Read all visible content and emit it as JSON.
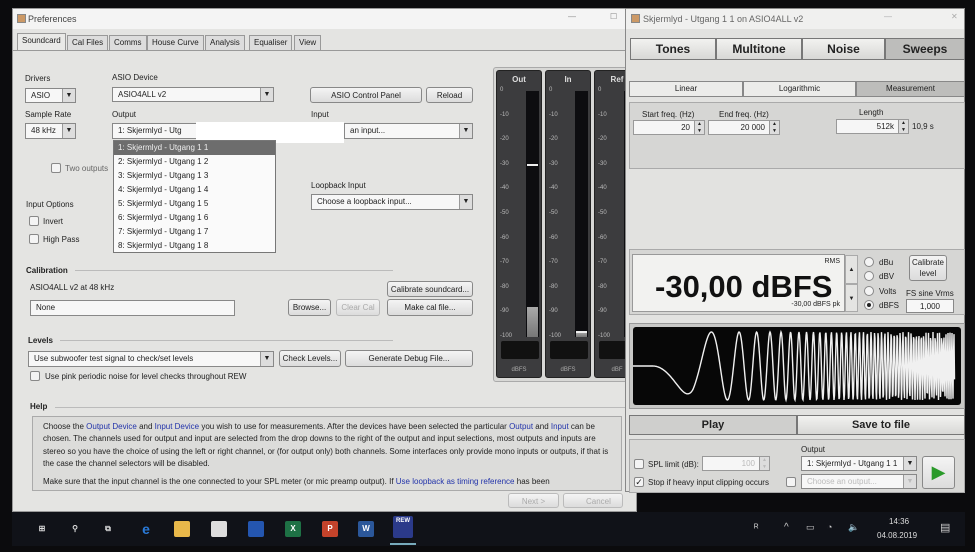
{
  "prefs": {
    "title": "Preferences",
    "tabs": [
      "Soundcard",
      "Cal Files",
      "Comms",
      "House Curve",
      "Analysis",
      "Equaliser",
      "View"
    ],
    "drivers_label": "Drivers",
    "drivers_value": "ASIO",
    "asio_device_label": "ASIO Device",
    "asio_device_value": "ASIO4ALL v2",
    "asio_control_panel": "ASIO Control Panel",
    "reload": "Reload",
    "sample_rate_label": "Sample Rate",
    "sample_rate_value": "48 kHz",
    "output_label": "Output",
    "output_value": "1: Skjermlyd - Utg",
    "input_label": "Input",
    "input_value": "an input...",
    "output_options": [
      "1: Skjermlyd - Utgang 1 1",
      "2: Skjermlyd - Utgang 1 2",
      "3: Skjermlyd - Utgang 1 3",
      "4: Skjermlyd - Utgang 1 4",
      "5: Skjermlyd - Utgang 1 5",
      "6: Skjermlyd - Utgang 1 6",
      "7: Skjermlyd - Utgang 1 7",
      "8: Skjermlyd - Utgang 1 8"
    ],
    "two_outputs": "Two outputs",
    "loopback_label": "Loopback Input",
    "loopback_value": "Choose a loopback input...",
    "input_options_label": "Input Options",
    "invert": "Invert",
    "high_pass": "High Pass",
    "calibration_label": "Calibration",
    "cal_device": "ASIO4ALL v2 at 48 kHz",
    "calibrate_soundcard": "Calibrate soundcard...",
    "cal_file_value": "None",
    "browse": "Browse...",
    "clear_cal": "Clear Cal",
    "make_cal_file": "Make cal file...",
    "levels_label": "Levels",
    "levels_value": "Use subwoofer test signal to check/set levels",
    "check_levels": "Check Levels...",
    "generate_debug": "Generate Debug File...",
    "pink_noise": "Use pink periodic noise for level checks throughout REW",
    "help_label": "Help",
    "help": {
      "p1a": "Choose the ",
      "l1": "Output Device",
      "p1b": " and ",
      "l2": "Input Device",
      "p1c": " you wish to use for measurements. After the devices have been selected the particular ",
      "l3": "Output",
      "p1d": " and ",
      "l4": "Input",
      "p1e": " can be chosen. The channels used for output and input are selected from the drop downs to the right of the output and input selections, most outputs and inputs are stereo so you have the choice of using the left or right channel, or (for output only) both channels. Some interfaces only provide mono inputs or outputs, if that is the case the channel selectors will be disabled.",
      "p2a": "Make sure that the input channel is the one connected to your SPL meter (or mic preamp output). If ",
      "l5": "Use loopback as timing reference",
      "p2b": " has been"
    },
    "next": "Next >",
    "cancel": "Cancel"
  },
  "meters": [
    {
      "label": "Out",
      "unit": "dBFS",
      "level": -88,
      "peak": -30
    },
    {
      "label": "In",
      "unit": "dBFS",
      "level": -98,
      "peak": -98
    },
    {
      "label": "Ref",
      "unit": "dBF",
      "level": null,
      "peak": null
    }
  ],
  "meter_ticks": [
    "0",
    "-10",
    "-20",
    "-30",
    "-40",
    "-50",
    "-60",
    "-70",
    "-80",
    "-90",
    "-100"
  ],
  "gen": {
    "title": "Skjermlyd - Utgang 1 1 on ASIO4ALL v2",
    "tabs": [
      "Tones",
      "Multitone",
      "Noise",
      "Sweeps"
    ],
    "subtabs": [
      "Linear",
      "Logarithmic",
      "Measurement"
    ],
    "start_label": "Start freq. (Hz)",
    "start_value": "20",
    "end_label": "End freq. (Hz)",
    "end_value": "20 000",
    "length_label": "Length",
    "length_value": "512k",
    "length_time": "10,9 s",
    "rms_label": "RMS",
    "level": "-30,00 dBFS",
    "peak": "-30,00 dBFS pk",
    "units": [
      "dBu",
      "dBV",
      "Volts",
      "dBFS"
    ],
    "calibrate": "Calibrate level",
    "fs_label": "FS sine Vrms",
    "fs_value": "1,000",
    "play": "Play",
    "save": "Save to file",
    "spl_limit": "SPL limit (dB):",
    "spl_value": "100",
    "stop_clip": "Stop if heavy input clipping occurs",
    "output_label": "Output",
    "output_value": "1: Skjermlyd - Utgang 1 1",
    "output2_value": "Choose an output..."
  },
  "taskbar": {
    "time": "14:36",
    "date": "04.08.2019",
    "rew": "REW"
  }
}
